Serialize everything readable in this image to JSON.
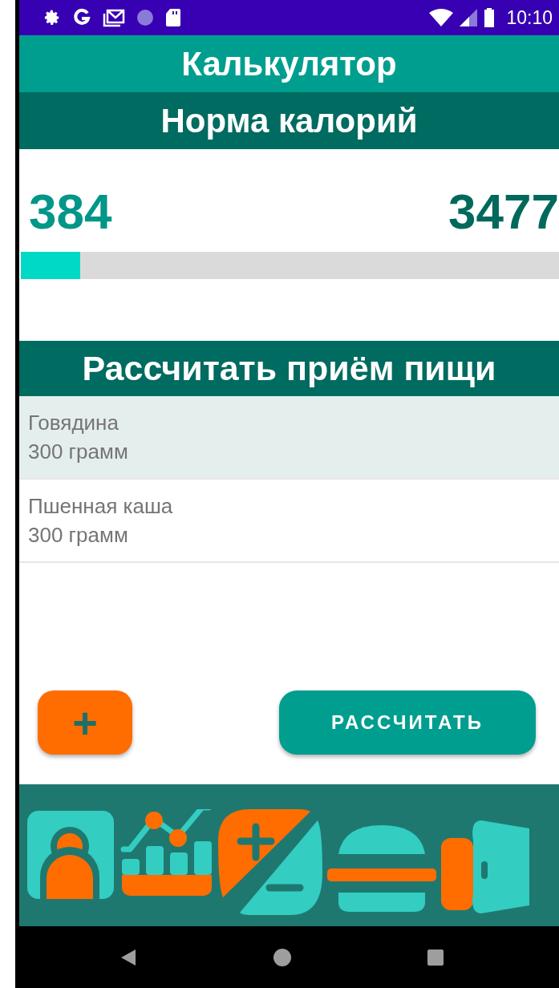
{
  "status_bar": {
    "time": "10:10"
  },
  "app_bar": {
    "title": "Калькулятор"
  },
  "calorie_norm": {
    "title": "Норма калорий",
    "consumed": "384",
    "total": "3477",
    "level": 0.11
  },
  "meal": {
    "title": "Рассчитать приём пищи",
    "items": [
      {
        "name": "Говядина",
        "amount": "300 грамм",
        "selected": true
      },
      {
        "name": "Пшенная каша",
        "amount": "300 грамм",
        "selected": false
      }
    ],
    "add_button": "+",
    "calculate_button": "РАССЧИТАТЬ"
  }
}
